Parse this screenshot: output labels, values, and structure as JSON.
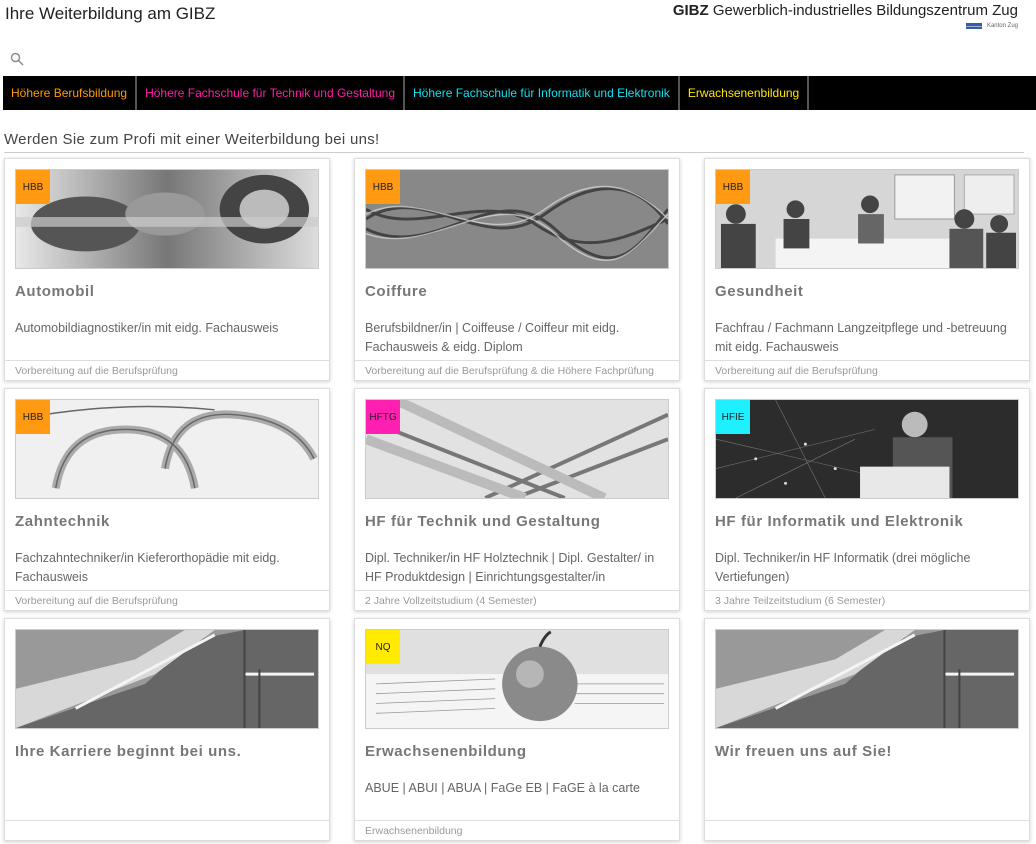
{
  "header": {
    "title": "Ihre Weiterbildung am GIBZ",
    "brand_bold": "GIBZ",
    "brand_rest": " Gewerblich-industrielles Bildungszentrum Zug",
    "canton": "Kanton Zug"
  },
  "search": {
    "icon": "search-icon"
  },
  "nav": [
    {
      "label": "Höhere Berufsbildung",
      "color": "#ff9a00"
    },
    {
      "label": "Höhere Fachschule für Technik und Gestaltung",
      "color": "#ff1fa8"
    },
    {
      "label": "Höhere Fachschule für Informatik und Elektronik",
      "color": "#14e0f0"
    },
    {
      "label": "Erwachsenenbildung",
      "color": "#ffe600"
    }
  ],
  "intro": "Werden Sie zum Profi mit einer Weiterbildung bei uns!",
  "cards": [
    {
      "badge": "HBB",
      "badge_color": "#ff9a12",
      "title": "Automobil",
      "desc": "Automobildiagnostiker/in mit eidg. Fachausweis",
      "footer": "Vorbereitung auf die Berufsprüfung",
      "image": "engine-camshaft-photo"
    },
    {
      "badge": "HBB",
      "badge_color": "#ff9a12",
      "title": "Coiffure",
      "desc": "Berufsbildner/in | Coiffeuse / Coiffeur mit eidg. Fachausweis & eidg. Diplom",
      "footer": "Vorbereitung auf die Berufsprüfung & die Höhere Fachprüfung",
      "image": "hair-braid-photo"
    },
    {
      "badge": "HBB",
      "badge_color": "#ff9a12",
      "title": "Gesundheit",
      "desc": "Fachfrau / Fachmann Langzeitpflege und -betreuung mit eidg. Fachausweis",
      "footer": "Vorbereitung auf die Berufsprüfung",
      "image": "classroom-group-photo"
    },
    {
      "badge": "HBB",
      "badge_color": "#ff9a12",
      "title": "Zahntechnik",
      "desc": "Fachzahntechniker/in Kieferorthopädie mit eidg. Fachausweis",
      "footer": "Vorbereitung auf die Berufsprüfung",
      "image": "dental-braces-photo"
    },
    {
      "badge": "HFTG",
      "badge_color": "#ff1fb0",
      "title": "HF für Technik und Gestaltung",
      "desc": "Dipl. Techniker/in HF Holztechnik | Dipl. Gestalter/ in HF Produktdesign | Einrichtungsgestalter/in",
      "footer": "2 Jahre Vollzeitstudium (4 Semester)",
      "image": "wood-strips-photo"
    },
    {
      "badge": "HFIE",
      "badge_color": "#1ff0ff",
      "title": "HF für Informatik und Elektronik",
      "desc": "Dipl. Techniker/in HF Informatik (drei mögliche Vertiefungen)",
      "footer": "3 Jahre Teilzeitstudium (6 Semester)",
      "image": "laptop-network-photo"
    },
    {
      "badge": "",
      "badge_color": "",
      "title": "Ihre Karriere beginnt bei uns.",
      "desc": "",
      "footer": "",
      "image": "staircase-photo"
    },
    {
      "badge": "NQ",
      "badge_color": "#ffea00",
      "title": "Erwachsenenbildung",
      "desc": "ABUE | ABUI | ABUA | FaGe EB | FaGE à la carte",
      "footer": "Erwachsenenbildung",
      "image": "apple-on-book-photo"
    },
    {
      "badge": "",
      "badge_color": "",
      "title": "Wir freuen uns auf Sie!",
      "desc": "",
      "footer": "",
      "image": "staircase-photo"
    }
  ]
}
